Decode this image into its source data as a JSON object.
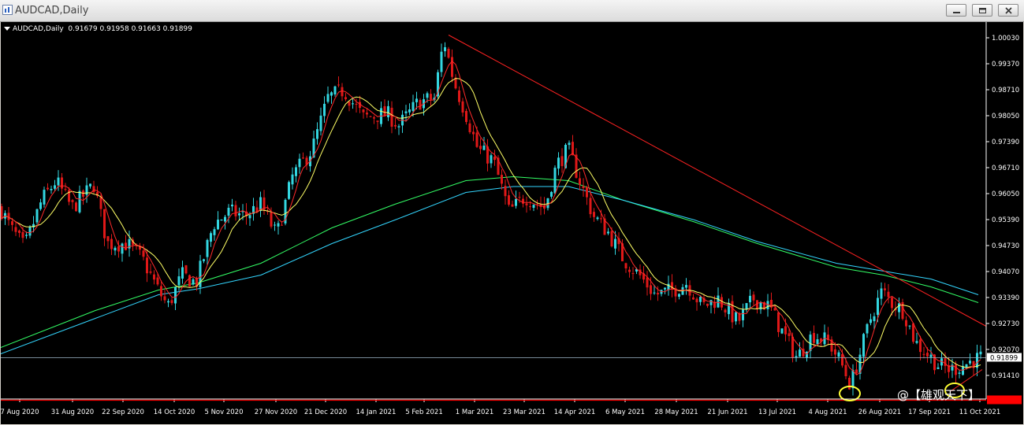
{
  "window": {
    "title": "AUDCAD,Daily"
  },
  "header": {
    "symbol": "AUDCAD,Daily",
    "ohlc": "0.91679 0.91958 0.91663 0.91899"
  },
  "current_price": "0.91899",
  "watermark": "@【雄观天下】",
  "colors": {
    "background": "#000000",
    "bull": "#33d6e0",
    "bear": "#e01818",
    "ma_fast": "#ff2a2a",
    "ma_mid": "#ffff66",
    "ma_slow1": "#33ff66",
    "ma_slow2": "#33d6ff",
    "trendline": "#ff2222",
    "support": "#ff0000",
    "highlight": "#ffff33"
  },
  "chart_data": {
    "type": "candlestick",
    "y_labels": [
      "1.00030",
      "0.99370",
      "0.98710",
      "0.98050",
      "0.97390",
      "0.96710",
      "0.96050",
      "0.95390",
      "0.94730",
      "0.94070",
      "0.93390",
      "0.92730",
      "0.92070",
      "0.91410"
    ],
    "x_labels": [
      "7 Aug 2020",
      "31 Aug 2020",
      "22 Sep 2020",
      "14 Oct 2020",
      "5 Nov 2020",
      "27 Nov 2020",
      "21 Dec 2020",
      "14 Jan 2021",
      "5 Feb 2021",
      "1 Mar 2021",
      "23 Mar 2021",
      "14 Apr 2021",
      "6 May 2021",
      "28 May 2021",
      "21 Jun 2021",
      "13 Jul 2021",
      "4 Aug 2021",
      "26 Aug 2021",
      "17 Sep 2021",
      "11 Oct 2021"
    ],
    "ylim": [
      0.908,
      1.003
    ],
    "last_price": 0.91899,
    "support_price": 0.9082,
    "trendline": {
      "from": [
        "9 Feb 2021",
        1.001
      ],
      "to": [
        "14 Oct 2021",
        0.927
      ]
    },
    "closes_approx": [
      {
        "date": "7 Aug 2020",
        "close": 0.955
      },
      {
        "date": "31 Aug 2020",
        "close": 0.961
      },
      {
        "date": "22 Sep 2020",
        "close": 0.947
      },
      {
        "date": "14 Oct 2020",
        "close": 0.935
      },
      {
        "date": "5 Nov 2020",
        "close": 0.952
      },
      {
        "date": "27 Nov 2020",
        "close": 0.954
      },
      {
        "date": "21 Dec 2020",
        "close": 0.98
      },
      {
        "date": "14 Jan 2021",
        "close": 0.984
      },
      {
        "date": "5 Feb 2021",
        "close": 0.987
      },
      {
        "date": "1 Mar 2021",
        "close": 0.978
      },
      {
        "date": "23 Mar 2021",
        "close": 0.959
      },
      {
        "date": "14 Apr 2021",
        "close": 0.97
      },
      {
        "date": "6 May 2021",
        "close": 0.95
      },
      {
        "date": "28 May 2021",
        "close": 0.937
      },
      {
        "date": "21 Jun 2021",
        "close": 0.933
      },
      {
        "date": "13 Jul 2021",
        "close": 0.929
      },
      {
        "date": "4 Aug 2021",
        "close": 0.918
      },
      {
        "date": "26 Aug 2021",
        "close": 0.932
      },
      {
        "date": "17 Sep 2021",
        "close": 0.918
      },
      {
        "date": "11 Oct 2021",
        "close": 0.919
      }
    ]
  }
}
